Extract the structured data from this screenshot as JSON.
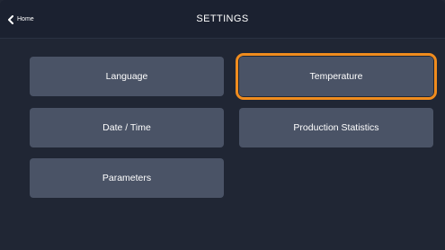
{
  "header": {
    "back_label": "Home",
    "title": "SETTINGS"
  },
  "menu": {
    "language": "Language",
    "temperature": "Temperature",
    "date_time": "Date / Time",
    "production_statistics": "Production Statistics",
    "parameters": "Parameters"
  },
  "selected_item": "temperature",
  "colors": {
    "background": "#202634",
    "tile": "#4a5366",
    "highlight": "#f08c1e",
    "text": "#ffffff"
  },
  "icons": {
    "back": "chevron-left-icon"
  }
}
